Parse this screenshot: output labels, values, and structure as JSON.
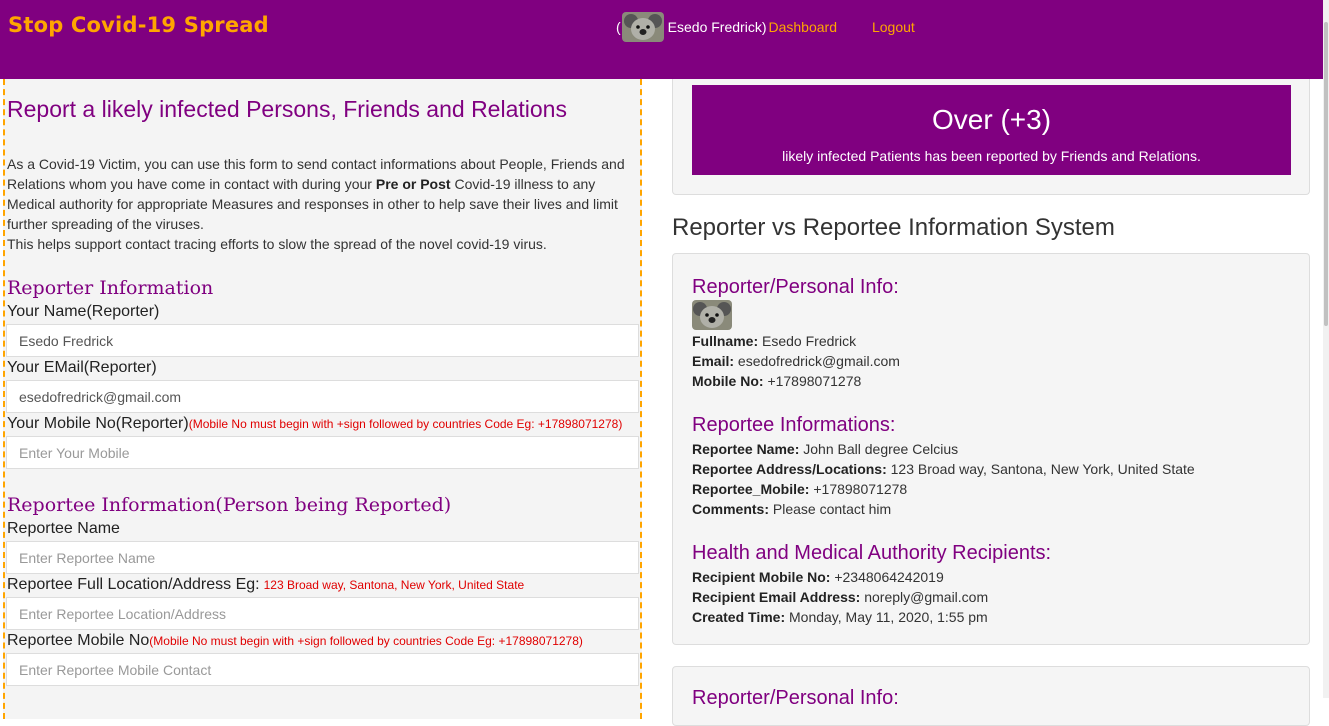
{
  "header": {
    "brand": "Stop Covid-19 Spread",
    "open_paren": "(",
    "user_name": "Esedo Fredrick)",
    "dashboard_link": "Dashboard",
    "logout_link": "Logout",
    "accent_color": "#ffa500",
    "bar_color": "#800080"
  },
  "form": {
    "title": "Report a likely infected Persons, Friends and Relations",
    "intro_part1": "As a Covid-19 Victim, you can use this form to send contact informations about People, Friends and Relations whom you have come in contact with during your ",
    "intro_bold": "Pre or Post",
    "intro_part2": " Covid-19 illness to any Medical authority for appropriate Measures and responses in other to help save their lives and limit further spreading of the viruses.",
    "intro_part3": "This helps support contact tracing efforts to slow the spread of the novel covid-19 virus.",
    "reporter_section": "Reporter Information",
    "name_label": "Your Name(Reporter)",
    "name_value": "Esedo Fredrick",
    "email_label": "Your EMail(Reporter)",
    "email_value": "esedofredrick@gmail.com",
    "mobile_label": "Your Mobile No(Reporter)",
    "mobile_hint": "(Mobile No must begin with +sign followed by countries Code Eg: +17898071278)",
    "mobile_placeholder": "Enter Your Mobile",
    "reportee_section": "Reportee Information(Person being Reported)",
    "reportee_name_label": "Reportee Name",
    "reportee_name_placeholder": "Enter Reportee Name",
    "reportee_location_label": "Reportee Full Location/Address Eg:",
    "reportee_location_hint": "123 Broad way, Santona, New York, United State",
    "reportee_location_placeholder": "Enter Reportee Location/Address",
    "reportee_mobile_label": "Reportee Mobile No",
    "reportee_mobile_hint": "(Mobile No must begin with +sign followed by countries Code Eg: +17898071278)",
    "reportee_mobile_placeholder": "Enter Reportee Mobile Contact"
  },
  "stats": {
    "count": "Over (+3)",
    "caption": "likely infected Patients has been reported by Friends and Relations."
  },
  "system": {
    "title": "Reporter vs Reportee Information System",
    "reporter_heading": "Reporter/Personal Info:",
    "fullname_label": "Fullname:",
    "fullname_value": "Esedo Fredrick",
    "email_label": "Email:",
    "email_value": "esedofredrick@gmail.com",
    "mobile_label": "Mobile No:",
    "mobile_value": "+17898071278",
    "reportee_heading": "Reportee Informations:",
    "reportee_name_label": "Reportee Name:",
    "reportee_name_value": "John Ball degree Celcius",
    "reportee_address_label": "Reportee Address/Locations:",
    "reportee_address_value": "123 Broad way, Santona, New York, United State",
    "reportee_mobile_label": "Reportee_Mobile:",
    "reportee_mobile_value": "+17898071278",
    "comments_label": "Comments:",
    "comments_value": "Please contact him",
    "authority_heading": "Health and Medical Authority Recipients:",
    "recipient_mobile_label": "Recipient Mobile No:",
    "recipient_mobile_value": "+2348064242019",
    "recipient_email_label": "Recipient Email Address:",
    "recipient_email_value": "noreply@gmail.com",
    "created_label": "Created Time:",
    "created_value": "Monday, May 11, 2020, 1:55 pm",
    "next_heading": "Reporter/Personal Info:"
  }
}
